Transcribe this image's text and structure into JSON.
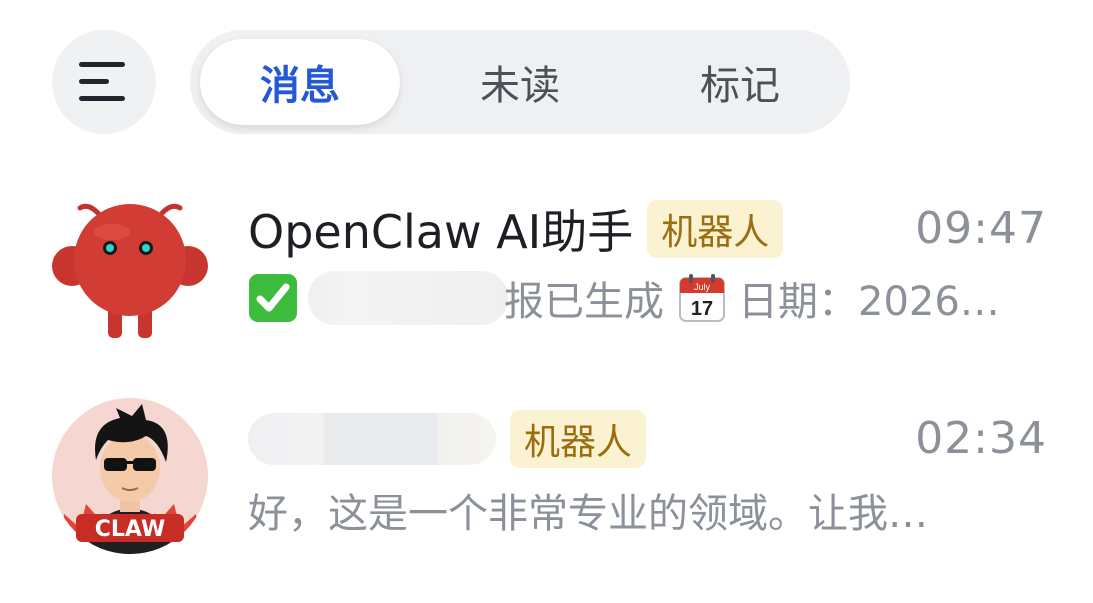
{
  "tabs": [
    {
      "label": "消息",
      "active": true
    },
    {
      "label": "未读",
      "active": false
    },
    {
      "label": "标记",
      "active": false
    }
  ],
  "icons": {
    "menu": "menu-lines-icon",
    "check": "green-check-icon",
    "calendar": "calendar-icon"
  },
  "colors": {
    "accent": "#2458d6",
    "badge_bg": "#fbf2d1",
    "badge_text": "#9a6e10",
    "check_green": "#3dbb3d",
    "calendar_red": "#d53a2f"
  },
  "calendar_glyph": {
    "month": "July",
    "day": "17"
  },
  "conversations": [
    {
      "name": "OpenClaw AI助手",
      "badge": "机器人",
      "time": "09:47",
      "preview_after_redaction": "报已生成",
      "preview_tail": "日期：2026…",
      "avatar": "red-crab-robot-avatar"
    },
    {
      "name": "",
      "badge": "机器人",
      "time": "02:34",
      "preview": "好，这是一个非常专业的领域。让我…",
      "avatar_label": "CLAW"
    }
  ]
}
